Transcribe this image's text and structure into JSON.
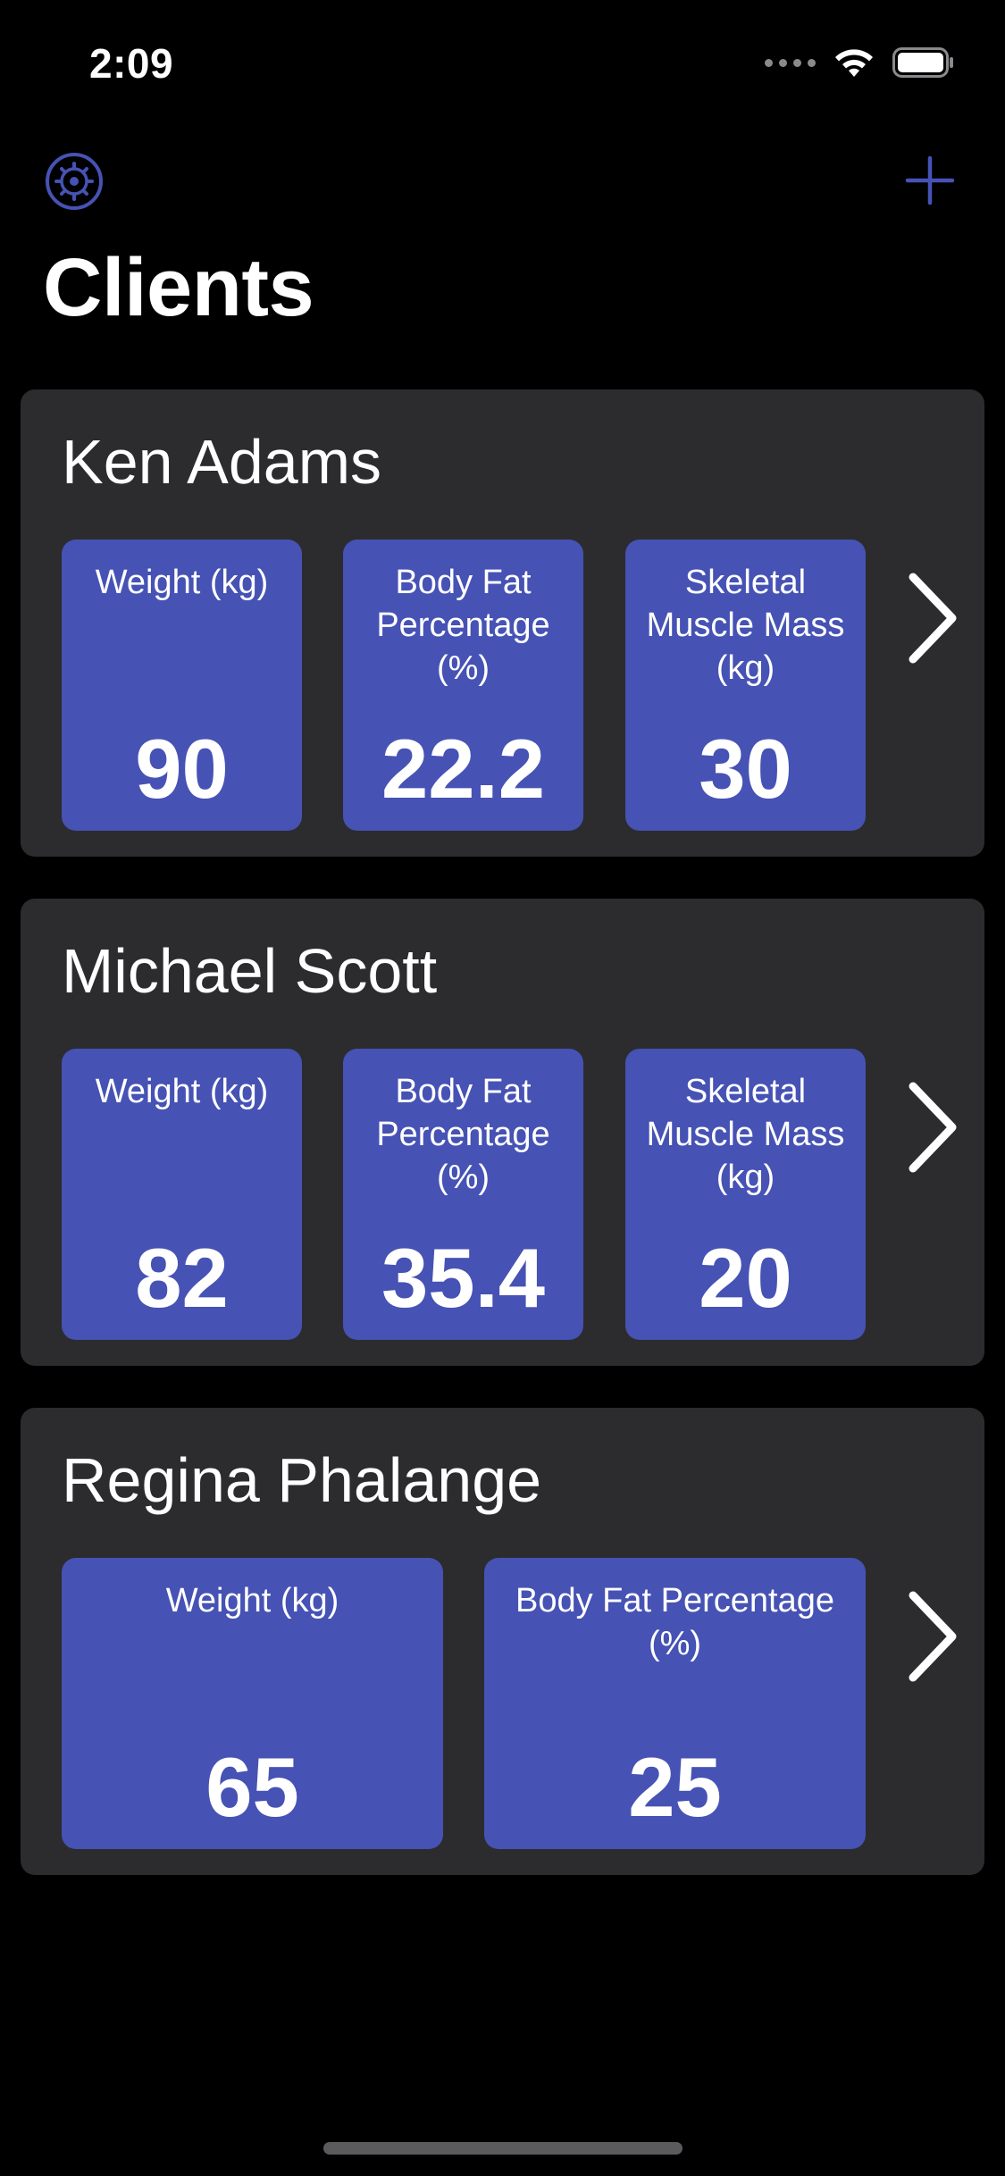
{
  "status_bar": {
    "time": "2:09"
  },
  "nav": {
    "settings_icon": "gear-icon",
    "add_icon": "plus-icon",
    "accent_color": "#4652b4"
  },
  "page": {
    "title": "Clients"
  },
  "clients": [
    {
      "name": "Ken Adams",
      "metrics": [
        {
          "label": "Weight (kg)",
          "value": "90"
        },
        {
          "label": "Body Fat Percentage (%)",
          "value": "22.2"
        },
        {
          "label": "Skeletal Muscle Mass (kg)",
          "value": "30"
        }
      ]
    },
    {
      "name": "Michael Scott",
      "metrics": [
        {
          "label": "Weight (kg)",
          "value": "82"
        },
        {
          "label": "Body Fat Percentage (%)",
          "value": "35.4"
        },
        {
          "label": "Skeletal Muscle Mass (kg)",
          "value": "20"
        }
      ]
    },
    {
      "name": "Regina Phalange",
      "metrics": [
        {
          "label": "Weight (kg)",
          "value": "65"
        },
        {
          "label": "Body Fat Percentage (%)",
          "value": "25"
        }
      ]
    }
  ],
  "colors": {
    "background": "#000000",
    "card": "#2c2c2e",
    "metric_tile": "#4652b4",
    "text": "#ffffff"
  }
}
